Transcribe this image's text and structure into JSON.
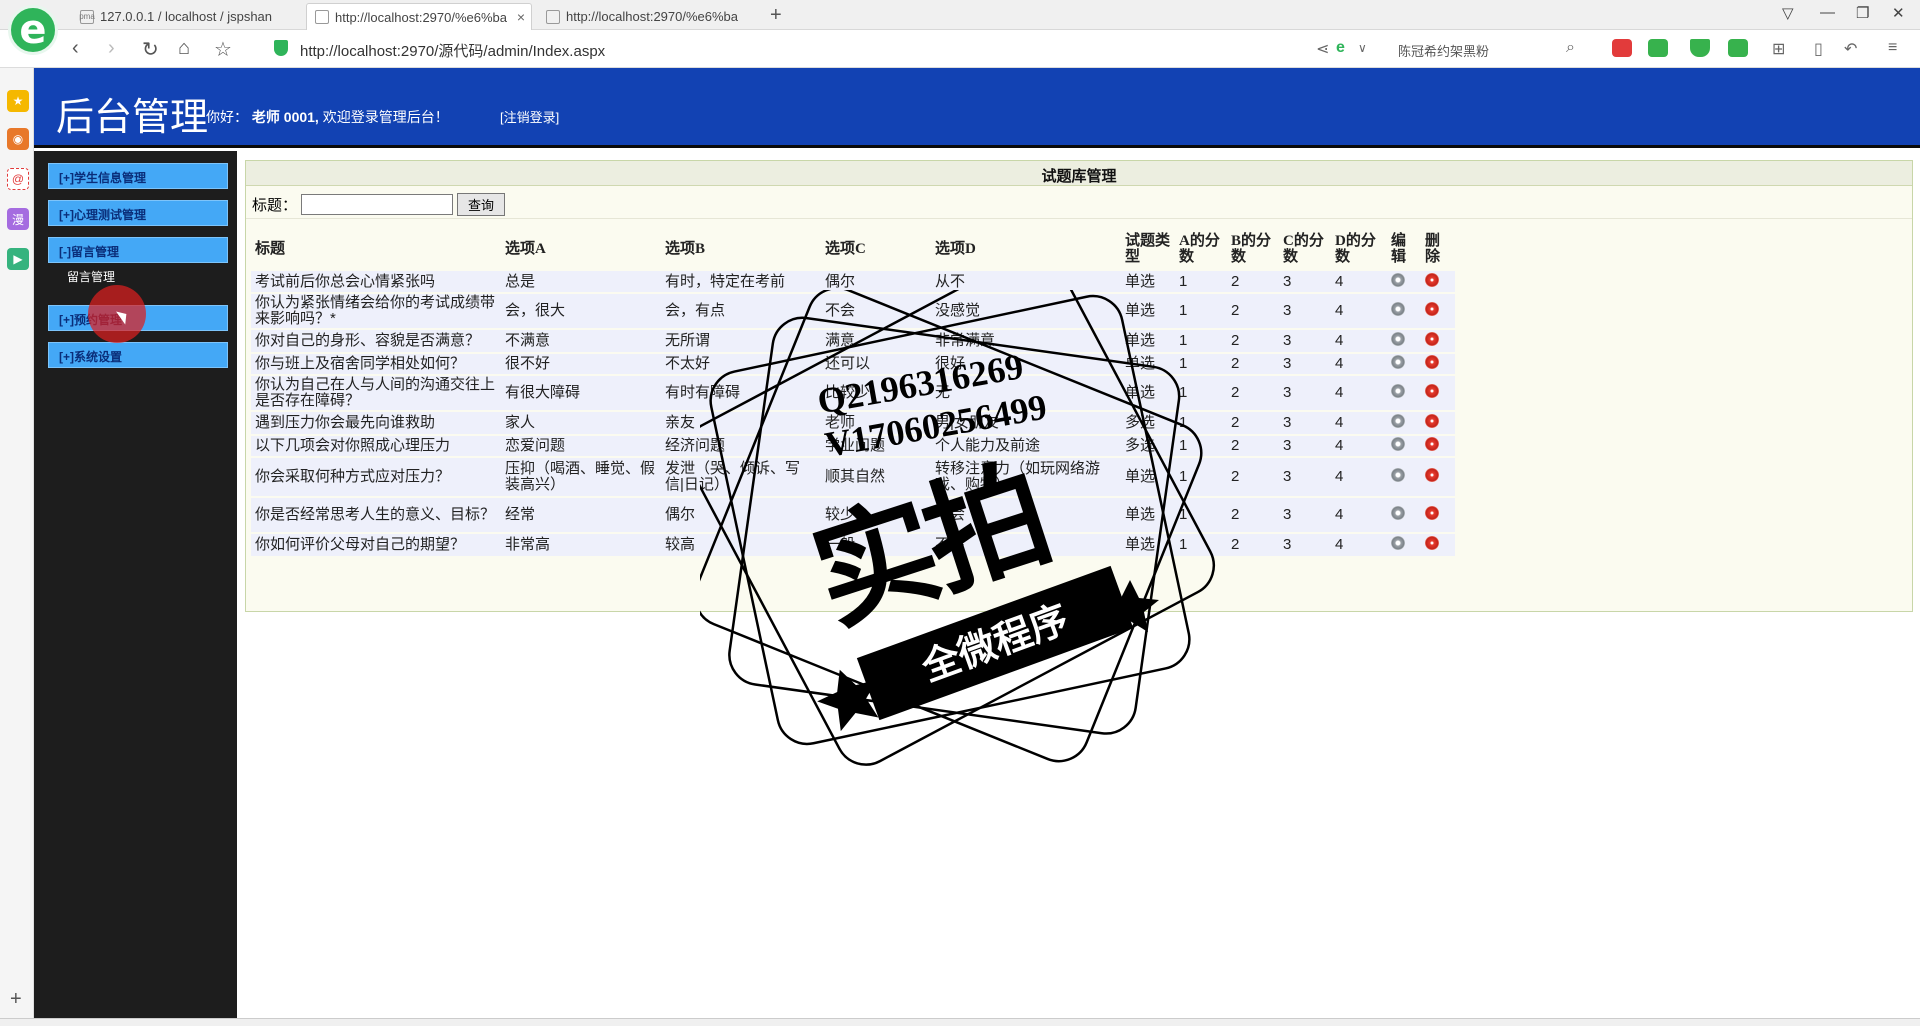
{
  "browser": {
    "tabs": [
      {
        "label": "127.0.0.1 / localhost / jspshan"
      },
      {
        "label": "http://localhost:2970/%e6%ba"
      },
      {
        "label": "http://localhost:2970/%e6%ba"
      }
    ],
    "url": "http://localhost:2970/源代码/admin/Index.aspx",
    "search_text": "陈冠希约架黑粉"
  },
  "app": {
    "title": "后台管理",
    "greeting_prefix": "你好：",
    "user": "老师 0001,",
    "greeting_suffix": "欢迎登录管理后台！",
    "logout": "[注销登录]"
  },
  "menu": {
    "items": [
      {
        "label": "[+]学生信息管理"
      },
      {
        "label": "[+]心理测试管理"
      },
      {
        "label": "[-]留言管理"
      },
      {
        "label": "[+]预约管理"
      },
      {
        "label": "[+]系统设置"
      }
    ],
    "submenu": "留言管理"
  },
  "panel": {
    "title": "试题库管理",
    "search_label": "标题：",
    "search_value": "",
    "search_button": "查询"
  },
  "table": {
    "headers": [
      "标题",
      "选项A",
      "选项B",
      "选项C",
      "选项D",
      "试题类型",
      "A的分数",
      "B的分数",
      "C的分数",
      "D的分数",
      "编辑",
      "删除"
    ],
    "rows": [
      [
        "考试前后你总会心情紧张吗",
        "总是",
        "有时，特定在考前",
        "偶尔",
        "从不",
        "单选",
        "1",
        "2",
        "3",
        "4"
      ],
      [
        "你认为紧张情绪会给你的考试成绩带来影响吗？*",
        "会，很大",
        "会，有点",
        "不会",
        "没感觉",
        "单选",
        "1",
        "2",
        "3",
        "4"
      ],
      [
        "你对自己的身形、容貌是否满意？",
        "不满意",
        "无所谓",
        "满意",
        "非常满意",
        "单选",
        "1",
        "2",
        "3",
        "4"
      ],
      [
        "你与班上及宿舍同学相处如何？",
        "很不好",
        "不太好",
        "还可以",
        "很好",
        "单选",
        "1",
        "2",
        "3",
        "4"
      ],
      [
        "你认为自己在人与人间的沟通交往上是否存在障碍？",
        "有很大障碍",
        "有时有障碍",
        "比较少",
        "无",
        "单选",
        "1",
        "2",
        "3",
        "4"
      ],
      [
        "遇到压力你会最先向谁救助",
        "家人",
        "亲友",
        "老师",
        "男|女朋友",
        "多选",
        "1",
        "2",
        "3",
        "4"
      ],
      [
        "以下几项会对你照成心理压力",
        "恋爱问题",
        "经济问题",
        "学业问题",
        "个人能力及前途",
        "多选",
        "1",
        "2",
        "3",
        "4"
      ],
      [
        "你会采取何种方式应对压力？",
        "压抑（喝酒、睡觉、假装高兴）",
        "发泄（哭、倾诉、写信|日记）",
        "顺其自然",
        "转移注意力（如玩网络游戏、购物）",
        "单选",
        "1",
        "2",
        "3",
        "4"
      ],
      [
        "你是否经常思考人生的意义、目标？",
        "经常",
        "偶尔",
        "较少",
        "不会",
        "单选",
        "1",
        "2",
        "3",
        "4"
      ],
      [
        "你如何评价父母对自己的期望？",
        "非常高",
        "较高",
        "一般",
        "不高",
        "单选",
        "1",
        "2",
        "3",
        "4"
      ]
    ]
  },
  "watermark": {
    "contact_1": "Q2196316269",
    "contact_2": "V17060256499",
    "big_text": "实拍",
    "ribbon_text": "全微程序"
  },
  "colors": {
    "header_blue": "#1242b3",
    "menu_blue": "#44a8f6",
    "sidebar_dark": "#1d1d1d"
  }
}
